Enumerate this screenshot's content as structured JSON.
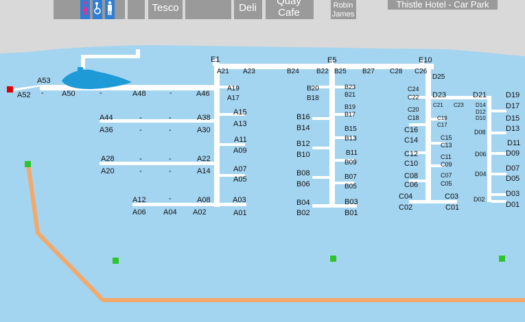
{
  "buildings": {
    "tesco": "Tesco",
    "deli": "Deli",
    "quay_cafe_line1": "Quay",
    "quay_cafe_line2": "Cafe",
    "robin_james_line1": "Robin",
    "robin_james_line2": "James",
    "hotel_car_park": "Thistle Hotel - Car Park"
  },
  "icons": {
    "toilets_female": "female-toilet-icon",
    "accessible": "accessible-toilet-icon",
    "toilets_male": "male-toilet-icon"
  },
  "colors": {
    "water": "#a3d4f0",
    "land": "#d9d9d9",
    "buildings": "#9a9a9a",
    "pontoons": "#ffffff",
    "boom": "#f2a96a",
    "buoy": "#2ec42e",
    "marker": "#e00000",
    "boat": "#1e9ad6"
  },
  "berths": {
    "E1": "E1",
    "E5": "E5",
    "E10": "E10",
    "A53": "A53",
    "A52": "A52",
    "A50": "A50",
    "A48": "A48",
    "A46": "A46",
    "A44": "A44",
    "A38": "A38",
    "A36": "A36",
    "A30": "A30",
    "A28": "A28",
    "A22": "A22",
    "A20": "A20",
    "A14": "A14",
    "A12": "A12",
    "A08": "A08",
    "A06": "A06",
    "A04": "A04",
    "A02": "A02",
    "A21": "A21",
    "A23": "A23",
    "A19": "A19",
    "A17": "A17",
    "A15": "A15",
    "A13": "A13",
    "A11": "A11",
    "A09": "A09",
    "A07": "A07",
    "A05": "A05",
    "A03": "A03",
    "A01": "A01",
    "B24": "B24",
    "B22": "B22",
    "B25": "B25",
    "B27": "B27",
    "B20": "B20",
    "B18": "B18",
    "B23": "B23",
    "B21": "B21",
    "B19": "B19",
    "B17": "B17",
    "B16": "B16",
    "B14": "B14",
    "B15": "B15",
    "B13": "B13",
    "B12": "B12",
    "B10": "B10",
    "B11": "B11",
    "B09": "B09",
    "B08": "B08",
    "B06": "B06",
    "B07": "B07",
    "B05": "B05",
    "B04": "B04",
    "B02": "B02",
    "B03": "B03",
    "B01": "B01",
    "C28": "C28",
    "C26": "C26",
    "C24": "C24",
    "C22": "C22",
    "C20": "C20",
    "C18": "C18",
    "C21": "C21",
    "C23": "C23",
    "C19": "C19",
    "C17": "C17",
    "C16": "C16",
    "C14": "C14",
    "C15": "C15",
    "C13": "C13",
    "C12": "C12",
    "C10": "C10",
    "C11": "C11",
    "C09": "C09",
    "C08": "C08",
    "C06": "C06",
    "C07": "C07",
    "C05": "C05",
    "C04": "C04",
    "C02": "C02",
    "C03": "C03",
    "C01": "C01",
    "D25": "D25",
    "D23": "D23",
    "D21": "D21",
    "D19": "D19",
    "D17": "D17",
    "D14": "D14",
    "D12": "D12",
    "D10": "D10",
    "D15": "D15",
    "D13": "D13",
    "D08": "D08",
    "D11": "D11",
    "D09": "D09",
    "D06": "D06",
    "D07": "D07",
    "D05": "D05",
    "D04": "D04",
    "D03": "D03",
    "D02": "D02",
    "D01": "D01",
    "dash": "-"
  }
}
